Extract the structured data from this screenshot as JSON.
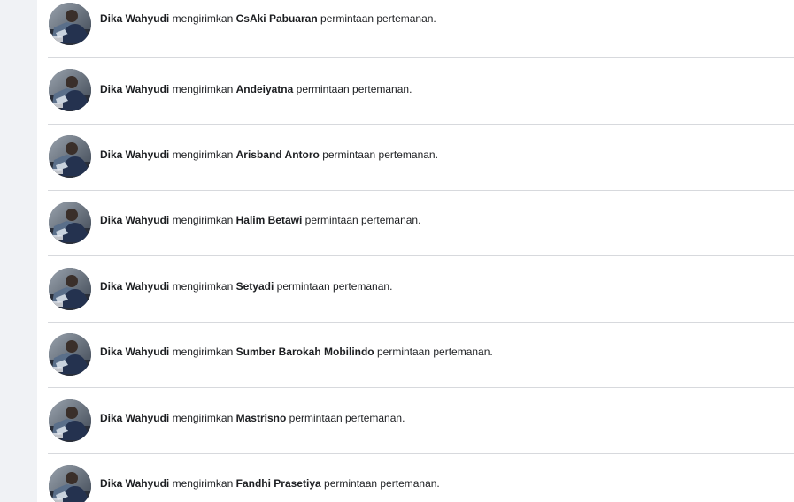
{
  "notifications": [
    {
      "actor": "Dika Wahyudi",
      "verb": "mengirimkan",
      "target": "CsAki Pabuaran",
      "suffix": "permintaan pertemanan."
    },
    {
      "actor": "Dika Wahyudi",
      "verb": "mengirimkan",
      "target": "Andeiyatna",
      "suffix": "permintaan pertemanan."
    },
    {
      "actor": "Dika Wahyudi",
      "verb": "mengirimkan",
      "target": "Arisband Antoro",
      "suffix": "permintaan pertemanan."
    },
    {
      "actor": "Dika Wahyudi",
      "verb": "mengirimkan",
      "target": "Halim Betawi",
      "suffix": "permintaan pertemanan."
    },
    {
      "actor": "Dika Wahyudi",
      "verb": "mengirimkan",
      "target": "Setyadi",
      "suffix": "permintaan pertemanan."
    },
    {
      "actor": "Dika Wahyudi",
      "verb": "mengirimkan",
      "target": "Sumber Barokah Mobilindo",
      "suffix": "permintaan pertemanan."
    },
    {
      "actor": "Dika Wahyudi",
      "verb": "mengirimkan",
      "target": "Mastrisno",
      "suffix": "permintaan pertemanan."
    },
    {
      "actor": "Dika Wahyudi",
      "verb": "mengirimkan",
      "target": "Fandhi Prasetiya",
      "suffix": "permintaan pertemanan."
    }
  ],
  "colors": {
    "rail_background": "#f0f2f5",
    "divider": "#d7d9dd",
    "text": "#1c1e21"
  }
}
